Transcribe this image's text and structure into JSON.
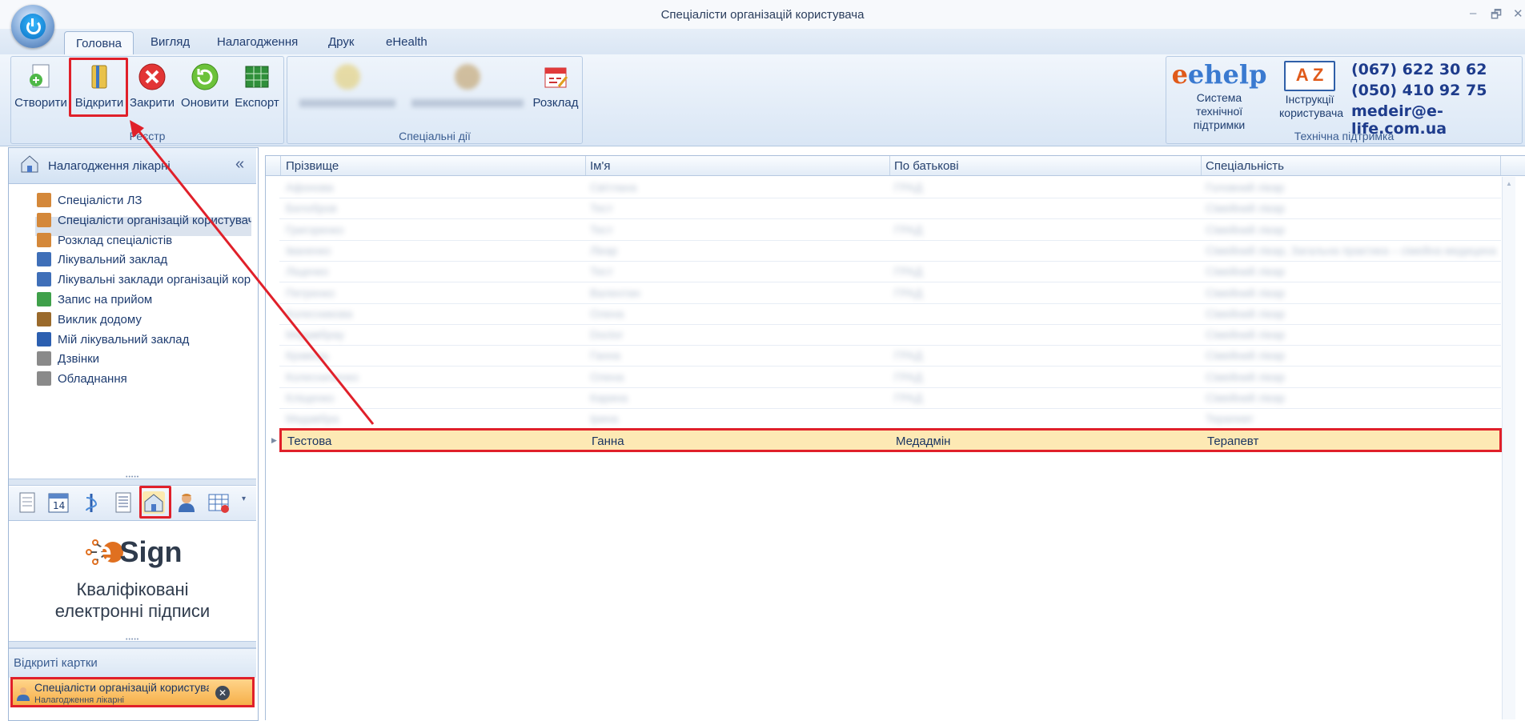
{
  "window": {
    "title": "Спеціалісти організацій користувача",
    "controls": [
      "–",
      "🗗",
      "✕"
    ]
  },
  "tabs": [
    "Головна",
    "Вигляд",
    "Налагодження",
    "Друк",
    "eHealth"
  ],
  "ribbon": {
    "registry": {
      "label": "Реєстр",
      "buttons": [
        "Створити",
        "Відкрити",
        "Закрити",
        "Оновити",
        "Експорт"
      ]
    },
    "special": {
      "label": "Спеціальні дії",
      "schedule_label": "Розклад"
    },
    "support": {
      "label": "Технічна підтримка",
      "ehelp_label": "Система технічної підтримки",
      "ehelp_logo": "ehelp",
      "instructions_label": "Інструкції користувача",
      "instructions_logo": "A Z",
      "phone1": "(067) 622 30 62",
      "phone2": "(050) 410 92 75",
      "email": "medeir@e-life.com.ua"
    }
  },
  "sidebar": {
    "title": "Налагодження лікарні",
    "collapse": "«",
    "items": [
      {
        "label": "Спеціалісти ЛЗ",
        "icon": "doctor-icon",
        "color": "#d4883a"
      },
      {
        "label": "Спеціалісти організацій користувача",
        "icon": "doctor-icon",
        "color": "#d4883a"
      },
      {
        "label": "Розклад спеціалістів",
        "icon": "doctor-icon",
        "color": "#d4883a"
      },
      {
        "label": "Лікувальний заклад",
        "icon": "grid-icon",
        "color": "#3f6fb8"
      },
      {
        "label": "Лікувальні заклади організацій користувача",
        "icon": "grid-icon",
        "color": "#3f6fb8"
      },
      {
        "label": "Запис на прийом",
        "icon": "clock-icon",
        "color": "#3fa04a"
      },
      {
        "label": "Виклик додому",
        "icon": "door-icon",
        "color": "#9a6a2c"
      },
      {
        "label": "Мій лікувальний заклад",
        "icon": "caduceus-icon",
        "color": "#2c5fb0"
      },
      {
        "label": "Дзвінки",
        "icon": "document-icon",
        "color": "#8a8a8a"
      },
      {
        "label": "Обладнання",
        "icon": "document-icon",
        "color": "#8a8a8a"
      }
    ],
    "esign": {
      "brand_prefix": "e",
      "brand_text": "Sign",
      "line1": "Кваліфіковані",
      "line2": "електронні підписи"
    },
    "open_cards": {
      "title": "Відкриті картки",
      "card_title": "Спеціалісти організацій користувача",
      "card_subtitle": "Налагодження лікарні"
    }
  },
  "grid": {
    "columns": [
      "Прізвище",
      "Ім'я",
      "По батькові",
      "Спеціальність"
    ],
    "blurred_rows": [
      [
        "Афонова",
        "Світлана",
        "ГРАД",
        "Головний лікар"
      ],
      [
        "Белобров",
        "Тест",
        "",
        "Сімейний лікар"
      ],
      [
        "Григоренко",
        "Тест",
        "ГРАД",
        "Сімейний лікар"
      ],
      [
        "Іваненко",
        "Лікар",
        "",
        "Сімейний лікар, Загальна практика – сімейна медицина"
      ],
      [
        "Ліщенко",
        "Тест",
        "ГРАД",
        "Сімейний лікар"
      ],
      [
        "Петренко",
        "Валентин",
        "ГРАД",
        "Сімейний лікар"
      ],
      [
        "Колесникова",
        "Олена",
        "",
        "Сімейний лікар"
      ],
      [
        "Медавбрау",
        "Doctor",
        "",
        "Сімейний лікар"
      ],
      [
        "Кравець",
        "Ганна",
        "ГРАД",
        "Сімейний лікар"
      ],
      [
        "Колесниченко",
        "Олена",
        "ГРАД",
        "Сімейний лікар"
      ],
      [
        "Кліщенко",
        "Карина",
        "ГРАД",
        "Сімейний лікар"
      ],
      [
        "Медавбра",
        "Ірина",
        "",
        "Терапевт"
      ]
    ],
    "selected_row": [
      "Тестова",
      "Ганна",
      "Медадмін",
      "Терапевт"
    ]
  }
}
